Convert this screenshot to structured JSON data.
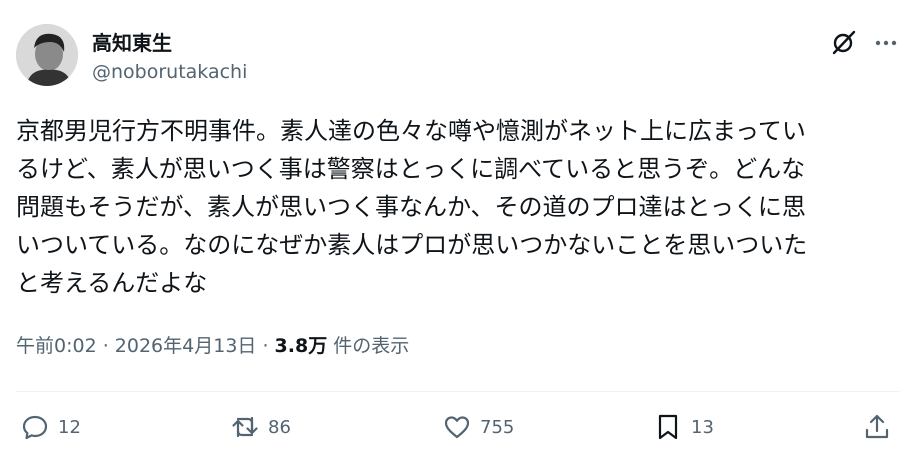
{
  "author": {
    "display_name": "高知東生",
    "handle": "@noborutakachi"
  },
  "header_icons": [
    "grok-icon",
    "more-icon"
  ],
  "tweet": {
    "text": "京都男児行方不明事件。素人達の色々な噂や憶測がネット上に広まってい\nるけど、素人が思いつく事は警察はとっくに調べていると思うぞ。どんな\n問題もそうだが、素人が思いつく事なんか、その道のプロ達はとっくに思\nいついている。なのになぜか素人はプロが思いつかないことを思いついた\nと考えるんだよな"
  },
  "meta": {
    "time": "午前0:02",
    "separator1": " · ",
    "date": "2026年4月13日",
    "separator2": " · ",
    "views_count": "3.8万",
    "views_label": " 件の表示"
  },
  "actions": {
    "reply": {
      "icon": "reply-icon",
      "count": "12"
    },
    "retweet": {
      "icon": "retweet-icon",
      "count": "86"
    },
    "like": {
      "icon": "heart-icon",
      "count": "755"
    },
    "bookmark": {
      "icon": "bookmark-icon",
      "count": "13"
    },
    "share": {
      "icon": "share-icon"
    }
  },
  "colors": {
    "text": "#0f1419",
    "secondary": "#536471",
    "divider": "#eff3f4"
  }
}
